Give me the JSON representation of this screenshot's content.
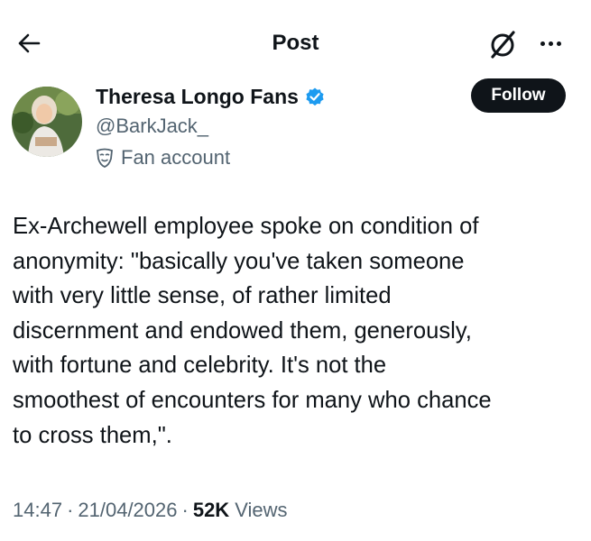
{
  "header": {
    "title": "Post"
  },
  "author": {
    "display_name": "Theresa Longo Fans",
    "handle": "@BarkJack_",
    "label": "Fan account",
    "verified": true
  },
  "follow_button": {
    "label": "Follow"
  },
  "tweet": {
    "text": "Ex-Archewell employee spoke on condition of\nanonymity:  \"basically you've taken someone\nwith very little sense, of rather limited\ndiscernment and endowed them, generously,\nwith fortune and celebrity. It's not the\nsmoothest of encounters for many who chance\nto cross them,\"."
  },
  "meta": {
    "time": "14:47",
    "date": "21/04/2026",
    "views_count": "52K",
    "views_label": "Views"
  },
  "colors": {
    "text": "#0f1419",
    "secondary": "#536471",
    "verified": "#1d9bf0",
    "button": "#0f1419"
  },
  "icons": [
    "back-arrow-icon",
    "grok-icon",
    "more-options-icon",
    "verified-badge-icon",
    "fan-mask-icon"
  ]
}
